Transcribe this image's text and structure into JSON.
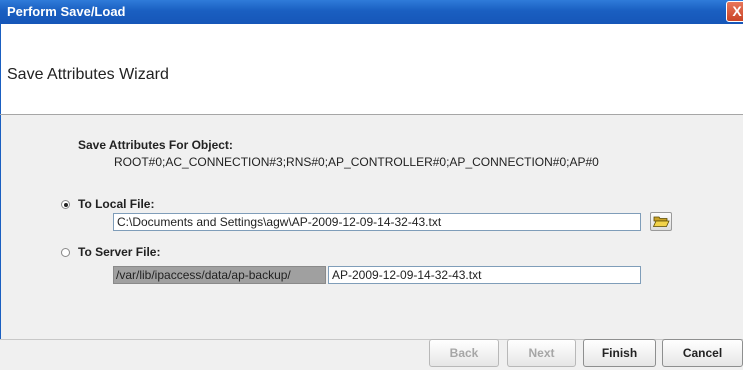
{
  "window": {
    "title": "Perform Save/Load",
    "close_glyph": "X"
  },
  "wizard": {
    "title": "Save Attributes Wizard"
  },
  "content": {
    "object_heading": "Save Attributes For Object:",
    "object_path": "ROOT#0;AC_CONNECTION#3;RNS#0;AP_CONTROLLER#0;AP_CONNECTION#0;AP#0",
    "local_option": {
      "label": "To Local File:",
      "selected": true,
      "value": "C:\\Documents and Settings\\agw\\AP-2009-12-09-14-32-43.txt"
    },
    "server_option": {
      "label": "To Server File:",
      "selected": false,
      "prefix": "/var/lib/ipaccess/data/ap-backup/",
      "value": "AP-2009-12-09-14-32-43.txt"
    },
    "browse_icon": "folder-open-icon"
  },
  "buttons": {
    "back": "Back",
    "next": "Next",
    "finish": "Finish",
    "cancel": "Cancel"
  }
}
